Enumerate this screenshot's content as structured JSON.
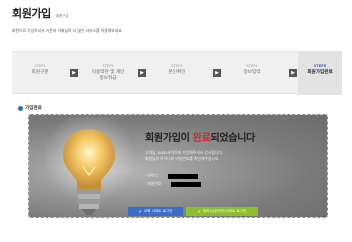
{
  "header": {
    "title": "회원가입",
    "subtitle": "회원구분",
    "description": "회원으로 가입하셔서 기존과 이회님의 더 많은 서비스를 이용해보세요."
  },
  "steps": [
    {
      "num": "STEP1",
      "label": "회원구분",
      "active": false
    },
    {
      "num": "STEP2",
      "label": "이용약관 및 개인정보취급",
      "active": false
    },
    {
      "num": "STEP3",
      "label": "본인확인",
      "active": false
    },
    {
      "num": "STEP4",
      "label": "정보입력",
      "active": false
    },
    {
      "num": "STEP5",
      "label": "회원가입완료",
      "active": true
    }
  ],
  "section": {
    "label": "가입완료"
  },
  "banner": {
    "title_before": "회원가입이 ",
    "title_accent": "완료",
    "title_after": "되었습니다",
    "message_line1": "고객님, KIRD사이트에 가입해주셔서 감사합니다.",
    "message_line2": "회원님의 아이디와 비밀번호를 확인해주십시오.",
    "id_label": "· 아이디",
    "member_label": "· 회원번호"
  },
  "buttons": {
    "blue_label": "교육 사이트 로그인",
    "green_label": "이러닝(온라인)사이트 로그인"
  },
  "colors": {
    "accent_red": "#d9232d",
    "blue": "#3b6cc8",
    "green": "#8cbe2e",
    "step_active": "#3a66b0"
  }
}
